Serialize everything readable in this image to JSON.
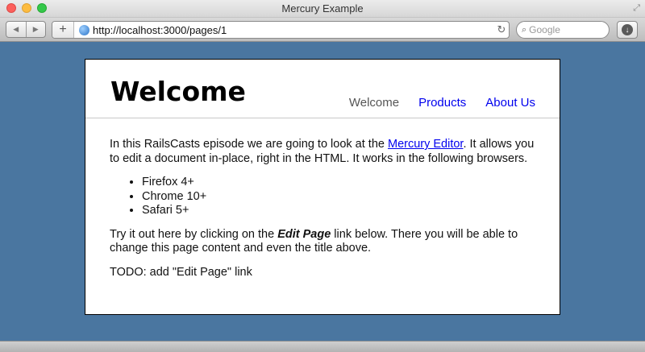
{
  "window": {
    "title": "Mercury Example"
  },
  "toolbar": {
    "url": "http://localhost:3000/pages/1",
    "search_placeholder": "Google",
    "icons": {
      "back": "back-arrow-icon",
      "forward": "forward-arrow-icon",
      "add": "plus-icon",
      "site": "globe-icon",
      "reload": "reload-icon",
      "search": "magnifier-icon",
      "downloads": "download-icon"
    }
  },
  "page": {
    "title": "Welcome",
    "nav": [
      {
        "label": "Welcome",
        "current": true
      },
      {
        "label": "Products",
        "current": false
      },
      {
        "label": "About Us",
        "current": false
      }
    ],
    "intro": {
      "before_link": "In this RailsCasts episode we are going to look at the ",
      "link_text": "Mercury Editor",
      "after_link": ". It allows you to edit a document in-place, right in the HTML. It works in the following browsers."
    },
    "browsers": [
      "Firefox 4+",
      "Chrome 10+",
      "Safari 5+"
    ],
    "try_it": {
      "before_bold": "Try it out here by clicking on the ",
      "bold_text": "Edit Page",
      "after_bold": " link below. There you will be able to change this page content and even the title above."
    },
    "todo": "TODO: add \"Edit Page\" link"
  },
  "colors": {
    "desktop_bg": "#4a76a0",
    "link": "#0000ee",
    "nav_current": "#555555"
  }
}
